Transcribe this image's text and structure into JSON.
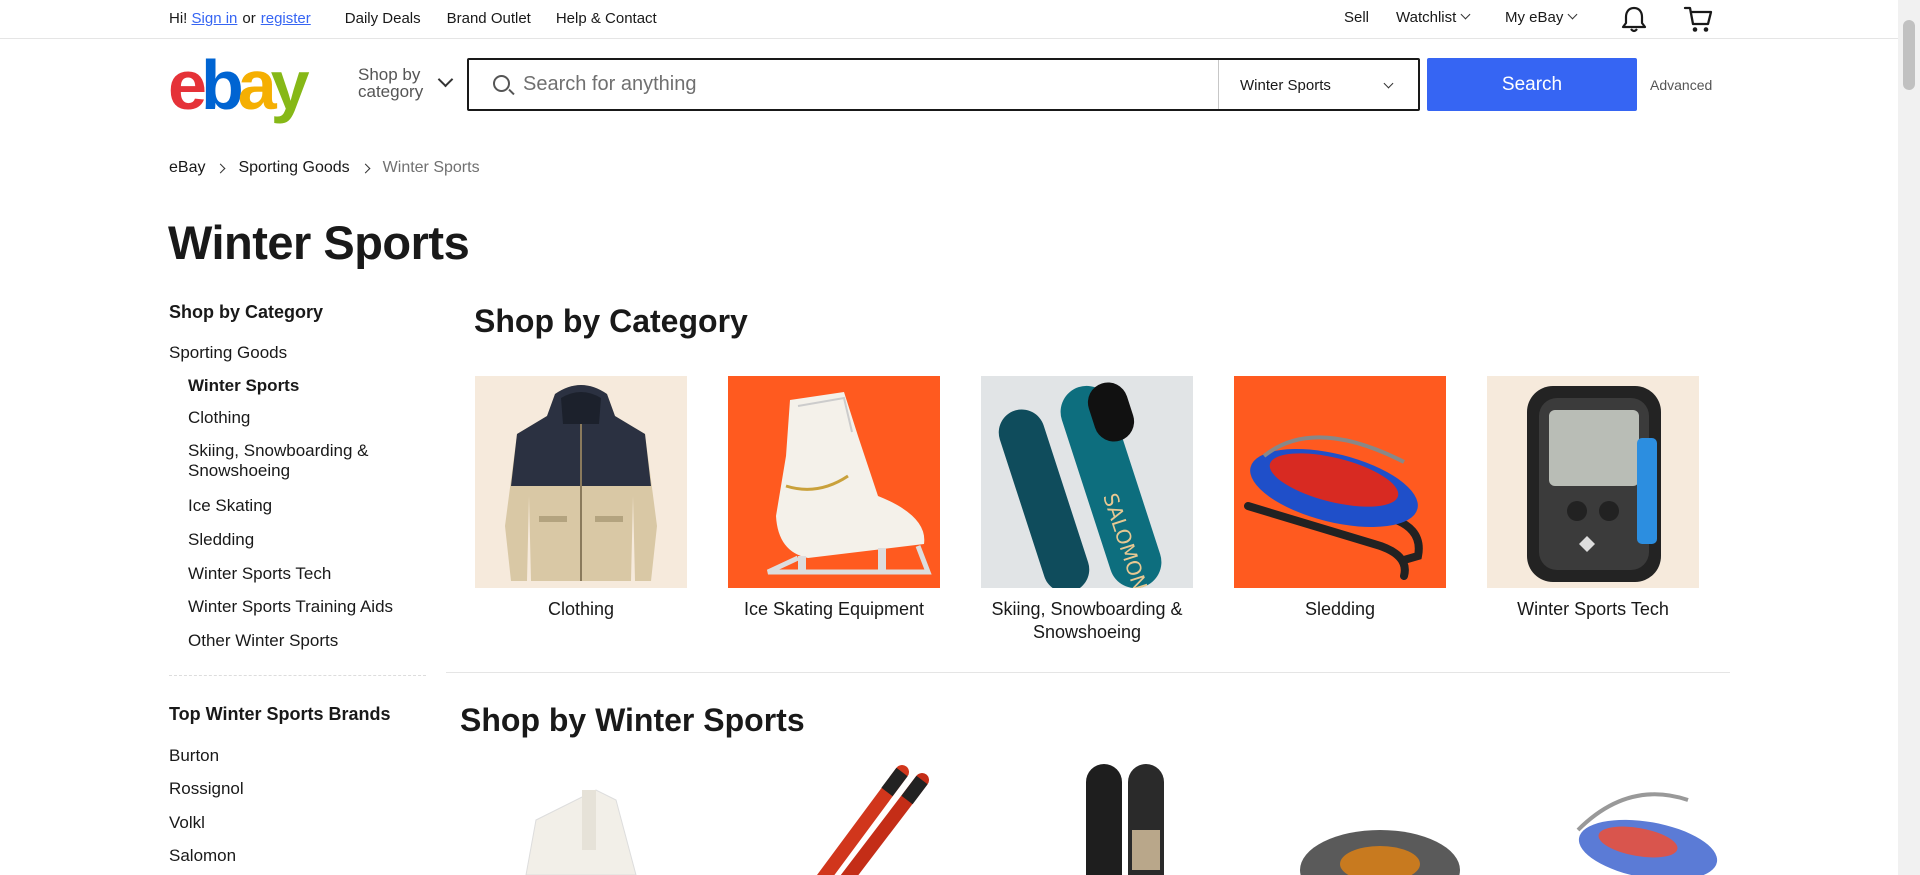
{
  "topbar": {
    "greeting": "Hi!",
    "sign_in": "Sign in",
    "or": "or",
    "register": "register",
    "daily_deals": "Daily Deals",
    "brand_outlet": "Brand Outlet",
    "help_contact": "Help & Contact",
    "sell": "Sell",
    "watchlist": "Watchlist",
    "my_ebay": "My eBay"
  },
  "header": {
    "logo_letters": [
      "e",
      "b",
      "a",
      "y"
    ],
    "logo_colors": [
      "#e53238",
      "#0064d2",
      "#f5af02",
      "#86b817"
    ],
    "shop_by_category_line1": "Shop by",
    "shop_by_category_line2": "category",
    "search_placeholder": "Search for anything",
    "search_category": "Winter Sports",
    "search_button": "Search",
    "advanced": "Advanced",
    "accent_color": "#3665f3"
  },
  "breadcrumb": [
    "eBay",
    "Sporting Goods",
    "Winter Sports"
  ],
  "page_title": "Winter Sports",
  "sidebar": {
    "heading": "Shop by Category",
    "parent": "Sporting Goods",
    "current": "Winter Sports",
    "items": [
      "Clothing",
      "Skiing, Snowboarding & Snowshoeing",
      "Ice Skating",
      "Sledding",
      "Winter Sports Tech",
      "Winter Sports Training Aids",
      "Other Winter Sports"
    ],
    "brands_heading": "Top Winter Sports Brands",
    "brands": [
      "Burton",
      "Rossignol",
      "Volkl",
      "Salomon"
    ]
  },
  "main": {
    "shop_by_category_title": "Shop by Category",
    "categories": [
      {
        "label": "Clothing",
        "icon": "jacket-image",
        "bg": "#f6eadc"
      },
      {
        "label": "Ice Skating Equipment",
        "icon": "ice-skate-image",
        "bg": "#ff5a1f"
      },
      {
        "label": "Skiing, Snowboarding & Snowshoeing",
        "icon": "snowboard-image",
        "bg": "#e1e4e6"
      },
      {
        "label": "Sledding",
        "icon": "sled-image",
        "bg": "#ff5a1f"
      },
      {
        "label": "Winter Sports Tech",
        "icon": "avalanche-beacon-image",
        "bg": "#f6eadc"
      }
    ],
    "shop_by_winter_sports_title": "Shop by Winter Sports",
    "sports": [
      "ice-skate-image",
      "skis-image",
      "snowboards-image",
      "snowshoe-image",
      "sled-image"
    ]
  }
}
